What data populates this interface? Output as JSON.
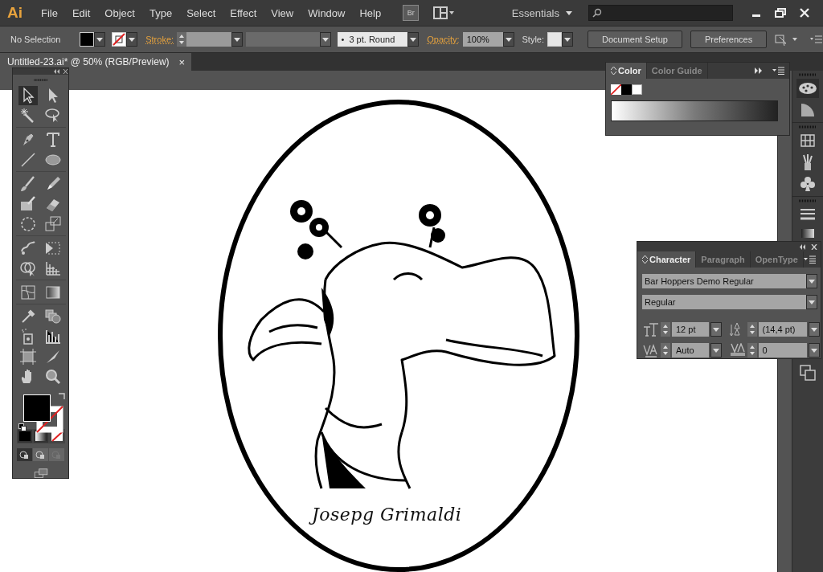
{
  "menubar": {
    "logo": "Ai",
    "menus": [
      "File",
      "Edit",
      "Object",
      "Type",
      "Select",
      "Effect",
      "View",
      "Window",
      "Help"
    ],
    "bridge": "Br",
    "workspace": "Essentials"
  },
  "controlbar": {
    "selection": "No Selection",
    "stroke_label": "Stroke:",
    "brush_bullet": "•",
    "brush": "3 pt. Round",
    "opacity_label": "Opacity:",
    "opacity": "100%",
    "style_label": "Style:",
    "buttons": [
      "Document Setup",
      "Preferences"
    ]
  },
  "document_tab": {
    "title": "Untitled-23.ai* @ 50% (RGB/Preview)",
    "close": "×"
  },
  "color_panel": {
    "tabs": [
      {
        "label": "Color",
        "selected": true
      },
      {
        "label": "Color Guide",
        "selected": false
      }
    ]
  },
  "character_panel": {
    "tabs": [
      {
        "label": "Character",
        "selected": true
      },
      {
        "label": "Paragraph",
        "selected": false
      },
      {
        "label": "OpenType",
        "selected": false
      }
    ],
    "font_family": "Bar Hoppers Demo Regular",
    "font_style": "Regular",
    "font_size": "12 pt",
    "leading": "(14,4 pt)",
    "kerning": "Auto",
    "tracking": "0"
  },
  "artwork": {
    "caption": "Josepg Grimaldi"
  }
}
